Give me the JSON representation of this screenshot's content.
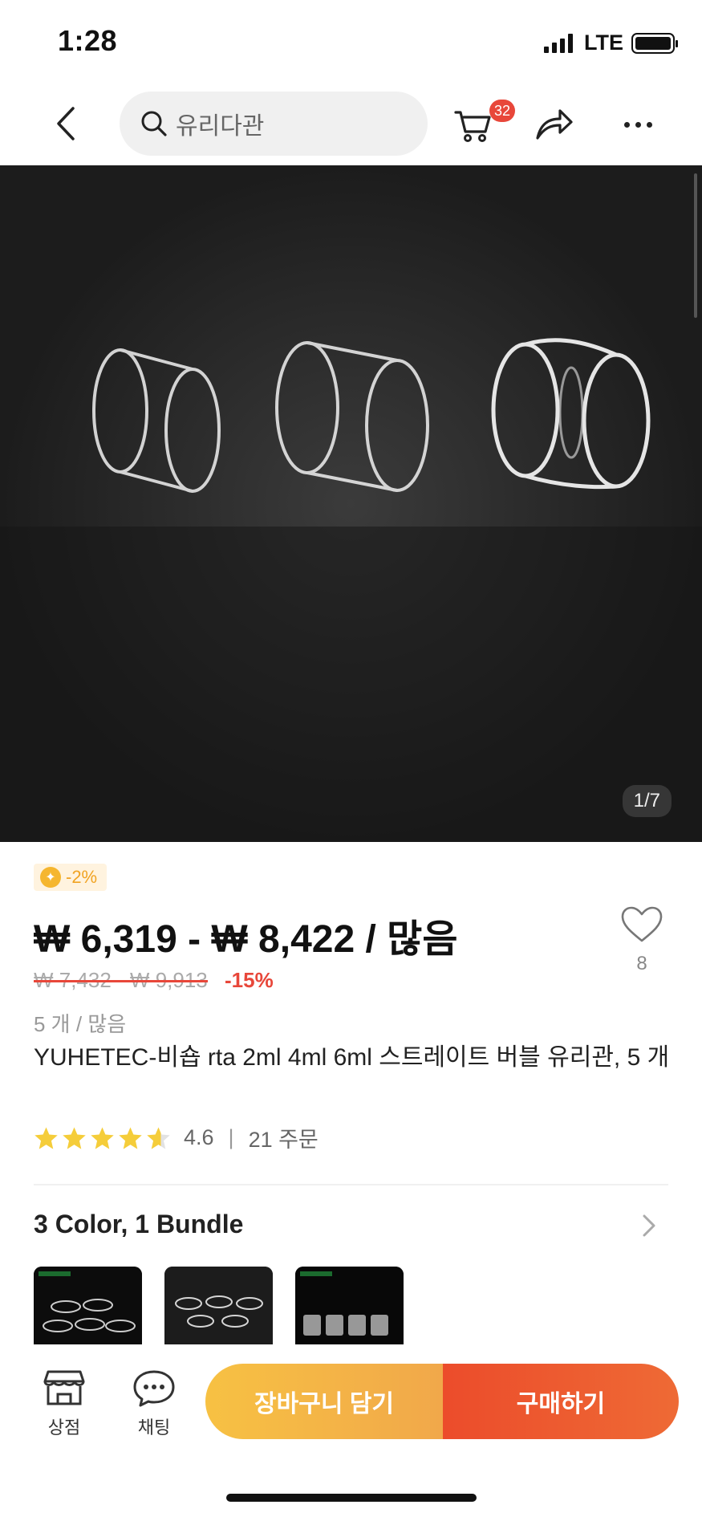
{
  "status_bar": {
    "time": "1:28",
    "network": "LTE"
  },
  "nav": {
    "search_placeholder": "유리다관",
    "cart_badge": "32"
  },
  "hero": {
    "image_counter": "1/7"
  },
  "product": {
    "coupon_label": "-2%",
    "price_range": "₩ 6,319 - ₩ 8,422 / 많음",
    "original_price": "₩ 7,432 - ₩ 9,913",
    "discount": "-15%",
    "unit": "5 개 / 많음",
    "title": "YUHETEC-비숍 rta 2ml 4ml 6ml 스트레이트 버블 유리관, 5 개",
    "rating": "4.6",
    "rating_stars": 4.6,
    "orders": "21 주문",
    "wishlist_count": "8"
  },
  "variants": {
    "title": "3 Color, 1 Bundle",
    "thumbnails": [
      "variant-1",
      "variant-2",
      "variant-3"
    ]
  },
  "bottom_bar": {
    "store_label": "상점",
    "chat_label": "채팅",
    "add_to_cart_label": "장바구니 담기",
    "buy_now_label": "구매하기"
  },
  "colors": {
    "accent_red": "#e8473a",
    "coupon_orange": "#f1a322",
    "star_yellow": "#f5cd3a",
    "cart_button": "#f7c143",
    "buy_button": "#ec4c2b"
  }
}
